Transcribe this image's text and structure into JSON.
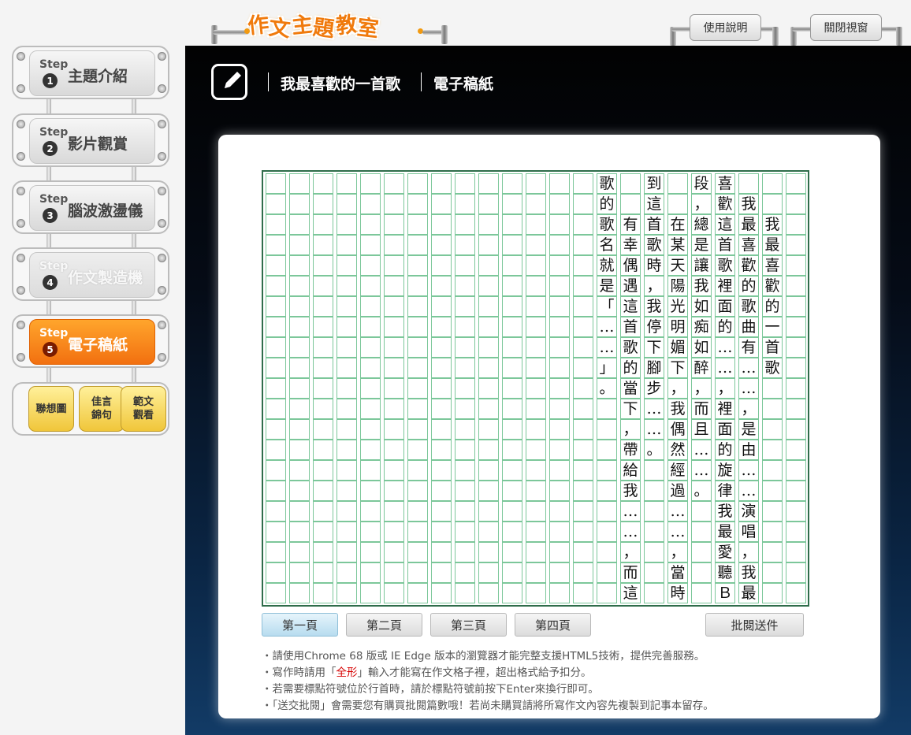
{
  "app": {
    "logo_chars": [
      "作",
      "文",
      "主",
      "題",
      "教",
      "室"
    ]
  },
  "top_buttons": {
    "help": "使用說明",
    "close": "關閉視窗"
  },
  "sidebar": {
    "step_word": "Step",
    "steps": [
      {
        "num": "1",
        "label": "主題介紹",
        "state": "normal"
      },
      {
        "num": "2",
        "label": "影片觀賞",
        "state": "normal"
      },
      {
        "num": "3",
        "label": "腦波激盪儀",
        "state": "normal"
      },
      {
        "num": "4",
        "label": "作文製造機",
        "state": "disabled"
      },
      {
        "num": "5",
        "label": "電子稿紙",
        "state": "active"
      }
    ],
    "tools": [
      {
        "line1": "聯想圖",
        "line2": ""
      },
      {
        "line1": "佳言",
        "line2": "錦句"
      },
      {
        "line1": "範文",
        "line2": "觀看"
      }
    ]
  },
  "header": {
    "icon": "edit-icon",
    "title": "我最喜歡的一首歌",
    "subtitle": "電子稿紙"
  },
  "grid": {
    "columns": 23,
    "rows": 21,
    "text_columns_right_to_left": [
      "　　我最喜歡的一首歌",
      "　我最喜歡的歌曲有",
      "喜歡這首歌裡面的",
      "段，總是讓我如痴如醉",
      "　　在某天陽光明媚下",
      "到這首歌時，我停下腳",
      "　　有幸偶遇這首歌的當下",
      "歌的歌名就是「"
    ],
    "columns_text": [
      "",
      "　　我最喜歡的一首歌",
      "　我最喜歡的歌曲有……，是由……演唱，我最",
      "喜歡這首歌裡面的……，裡面的旋律我最愛聽Ｂ",
      "段，總是讓我如痴如醉，而且……。",
      "　　在某天陽光明媚下，我偶然經過……，當時聽",
      "到這首歌時，我停下腳步……。",
      "　　有幸偶遇這首歌的當下，帶給我……，而這首",
      "歌的歌名就是「……」。"
    ]
  },
  "pages": {
    "buttons": [
      "第一頁",
      "第二頁",
      "第三頁",
      "第四頁"
    ],
    "current": 0,
    "submit": "批閱送件"
  },
  "notes": {
    "line1": "・請使用Chrome 68 版或 IE Edge 版本的瀏覽器才能完整支援HTML5技術，提供完善服務。",
    "line2_a": "・寫作時請用「",
    "line2_red": "全形",
    "line2_b": "」輸入才能寫在作文格子裡，超出格式給予扣分。",
    "line3": "・若需要標點符號位於行首時，請於標點符號前按下Enter來換行即可。",
    "line4": "・「送交批閱」會需要您有購買批閱篇數哦！若尚未購買請將所寫作文內容先複製到記事本留存。"
  },
  "colors": {
    "accent_orange": "#f27010",
    "grid_line": "#7cc79a",
    "grid_border": "#2f6d4b",
    "note_red": "#d60000"
  }
}
